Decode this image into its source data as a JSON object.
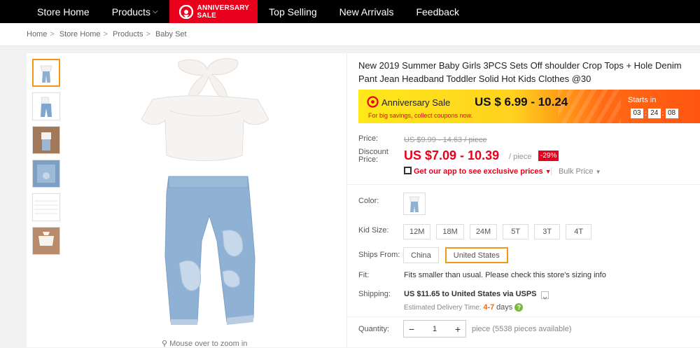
{
  "nav": {
    "items": [
      "Store Home",
      "Products",
      "Top Selling",
      "New Arrivals",
      "Feedback"
    ],
    "anniversary_line1": "ANNIVERSARY",
    "anniversary_line2": "SALE"
  },
  "breadcrumb": [
    "Home",
    "Store Home",
    "Products",
    "Baby Set"
  ],
  "gallery": {
    "zoom_hint": "Mouse over to zoom in"
  },
  "product": {
    "title": "New 2019 Summer Baby Girls 3PCS Sets Off shoulder Crop Tops + Hole Denim Pant Jean Headband Toddler Solid Hot Kids Clothes @30",
    "banner": {
      "label": "Anniversary Sale",
      "price_range": "US $ 6.99 - 10.24",
      "subtext": "For big savings, collect coupons now.",
      "starts_in": "Starts in",
      "timer": [
        "03",
        "24",
        "08"
      ]
    },
    "price_label": "Price:",
    "old_price": "US $9.99 - 14.63 / piece",
    "discount_label_1": "Discount",
    "discount_label_2": "Price:",
    "discount_price": "US $7.09 - 10.39",
    "per_piece": "/ piece",
    "discount_badge": "-29%",
    "get_app": "Get our app to see exclusive prices",
    "bulk_price": "Bulk Price",
    "color_label": "Color:",
    "size_label": "Kid Size:",
    "sizes": [
      "12M",
      "18M",
      "24M",
      "5T",
      "3T",
      "4T"
    ],
    "ships_label": "Ships From:",
    "ships_options": [
      "China",
      "United States"
    ],
    "ships_selected": "United States",
    "fit_label": "Fit:",
    "fit_text": "Fits smaller than usual. Please check this store's sizing info",
    "shipping_label": "Shipping:",
    "shipping_text": "US $11.65 to United States via USPS",
    "delivery_prefix": "Estimated Delivery Time:",
    "delivery_range": "4-7",
    "delivery_days": "days",
    "quantity_label": "Quantity:",
    "quantity": "1",
    "availability": "piece (5538 pieces available)"
  },
  "colors": {
    "accent": "#e8001c",
    "selected_border": "#f19a16",
    "nav_bg": "#000000"
  }
}
